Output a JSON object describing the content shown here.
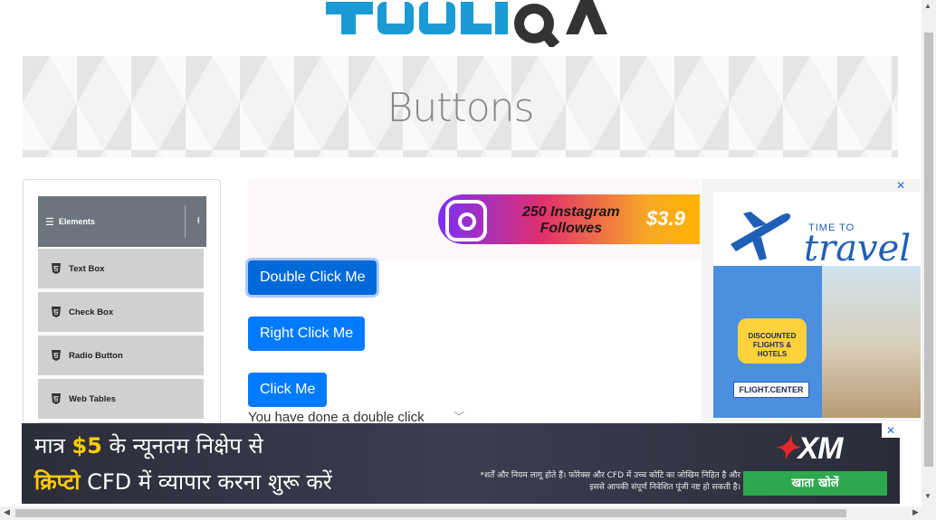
{
  "logo": {
    "text": "TOOLSQA"
  },
  "banner": {
    "title": "Buttons"
  },
  "sidebar": {
    "group": {
      "label": "Elements",
      "icon": "menu-icon",
      "toggle_icon": "collapse-up-icon"
    },
    "items": [
      {
        "label": "Text Box",
        "icon": "html5-icon"
      },
      {
        "label": "Check Box",
        "icon": "html5-icon"
      },
      {
        "label": "Radio Button",
        "icon": "html5-icon"
      },
      {
        "label": "Web Tables",
        "icon": "html5-icon"
      }
    ]
  },
  "main": {
    "ad_top": {
      "line1": "250 Instagram",
      "line2": "Followes",
      "price": "$3.9"
    },
    "buttons": {
      "double_click": "Double Click Me",
      "right_click": "Right Click Me",
      "click": "Click Me"
    },
    "message": "You have done a double click"
  },
  "ad_right": {
    "close": "✕",
    "time_to": "TIME TO",
    "travel": "travel",
    "bubble_line1": "DISCOUNTED",
    "bubble_line2": "FLIGHTS & HOTELS",
    "brand": "FLIGHT.CENTER"
  },
  "ad_bottom": {
    "line1_pre": "मात्र ",
    "line1_amount": "$5",
    "line1_post": " के न्यूनतम निक्षेप से",
    "line2_hl": "क्रिप्टो",
    "line2_post": " CFD में व्यापार करना शुरू करें",
    "fine_print": "*शर्तें और नियम लागू होते हैं। फोरेक्स और CFD में उच्च कोटि का जोखिम निहित है और इससे आपकी संपूर्ण निवेशित पूंजी नष्ट हो सकती है।",
    "brand": "XM",
    "cta": "खाता खोलें",
    "close": "✕"
  },
  "colors": {
    "primary": "#007bff",
    "sidebar_header": "#6c757d",
    "menu_item": "#d0d0d0"
  }
}
